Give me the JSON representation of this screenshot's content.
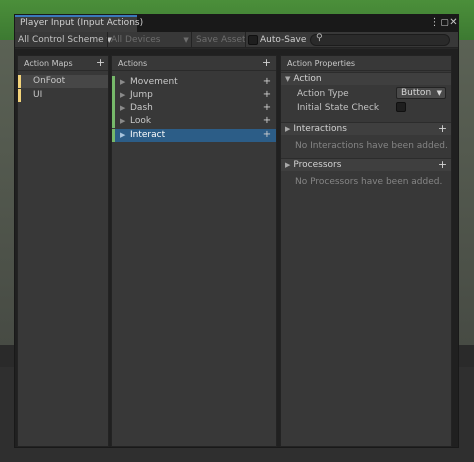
{
  "window": {
    "tab_title": "Player Input (Input Actions)",
    "menu_icon": "kebab-menu-icon",
    "maximize_icon": "maximize-icon",
    "close_icon": "close-icon"
  },
  "toolbar": {
    "control_scheme": "All Control Scheme",
    "devices": "All Devices",
    "save_asset": "Save Asset",
    "auto_save_label": "Auto-Save",
    "auto_save_checked": false,
    "search_value": ""
  },
  "action_maps": {
    "header": "Action Maps",
    "items": [
      {
        "label": "OnFoot",
        "selected": true,
        "color": "#f2d37a"
      },
      {
        "label": "UI",
        "selected": false,
        "color": "#f2d37a"
      }
    ]
  },
  "actions": {
    "header": "Actions",
    "items": [
      {
        "label": "Movement",
        "selected": false,
        "color": "#76b86a"
      },
      {
        "label": "Jump",
        "selected": false,
        "color": "#76b86a"
      },
      {
        "label": "Dash",
        "selected": false,
        "color": "#76b86a"
      },
      {
        "label": "Look",
        "selected": false,
        "color": "#76b86a"
      },
      {
        "label": "Interact",
        "selected": true,
        "color": "#76b86a"
      }
    ]
  },
  "properties": {
    "header": "Action Properties",
    "action_section": "Action",
    "action_type_label": "Action Type",
    "action_type_value": "Button",
    "initial_state_label": "Initial State Check",
    "initial_state_checked": false,
    "interactions_section": "Interactions",
    "interactions_empty": "No Interactions have been added.",
    "processors_section": "Processors",
    "processors_empty": "No Processors have been added."
  },
  "colors": {
    "selection": "#2c5d87",
    "tab_accent": "#3a79bb"
  }
}
